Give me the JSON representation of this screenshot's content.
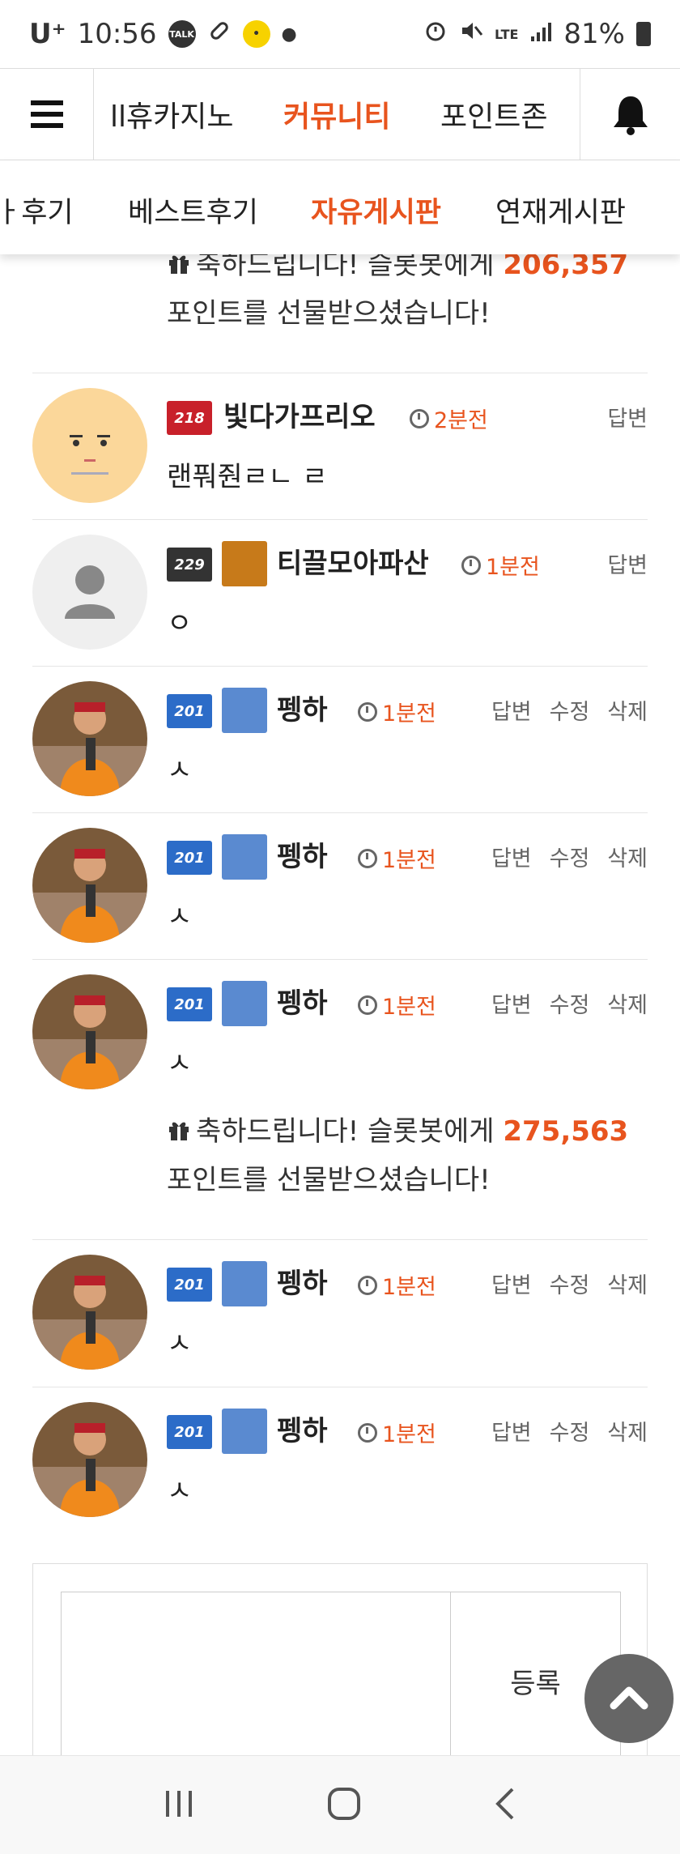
{
  "status_bar": {
    "carrier": "U⁺",
    "time": "10:56",
    "talk_icon": "TALK",
    "network": "LTE",
    "battery": "81%"
  },
  "top_nav": {
    "tabs": [
      {
        "label": "ll휴카지노",
        "active": false
      },
      {
        "label": "커뮤니티",
        "active": true
      },
      {
        "label": "포인트존",
        "active": false
      }
    ]
  },
  "sub_nav": {
    "tabs": [
      {
        "label": "ㅏ후기",
        "active": false
      },
      {
        "label": "베스트후기",
        "active": false
      },
      {
        "label": "자유게시판",
        "active": true
      },
      {
        "label": "연재게시판",
        "active": false
      }
    ]
  },
  "gifts": [
    {
      "prefix": "축하드립니다! 슬롯봇에게",
      "points": "206,357",
      "suffix": "포인트를 선물받으셨습니다!"
    },
    {
      "prefix": "축하드립니다! 슬롯봇에게",
      "points": "275,563",
      "suffix": "포인트를 선물받으셨습니다!"
    }
  ],
  "comments": [
    {
      "level": "218",
      "nickname": "빛다가프리오",
      "time": "2분전",
      "text": "랜풔줜ㄹㄴ ㄹ",
      "actions": [
        "답변"
      ],
      "avatar": "face-avatar"
    },
    {
      "level": "229",
      "nickname": "티끌모아파산",
      "time": "1분전",
      "text": "ㅇ",
      "actions": [
        "답변"
      ],
      "avatar": "default-avatar"
    },
    {
      "level": "201",
      "nickname": "펭하",
      "time": "1분전",
      "text": "ㅅ",
      "actions": [
        "답변",
        "수정",
        "삭제"
      ],
      "avatar": "photo-avatar"
    },
    {
      "level": "201",
      "nickname": "펭하",
      "time": "1분전",
      "text": "ㅅ",
      "actions": [
        "답변",
        "수정",
        "삭제"
      ],
      "avatar": "photo-avatar"
    },
    {
      "level": "201",
      "nickname": "펭하",
      "time": "1분전",
      "text": "ㅅ",
      "actions": [
        "답변",
        "수정",
        "삭제"
      ],
      "avatar": "photo-avatar"
    },
    {
      "level": "201",
      "nickname": "펭하",
      "time": "1분전",
      "text": "ㅅ",
      "actions": [
        "답변",
        "수정",
        "삭제"
      ],
      "avatar": "photo-avatar"
    },
    {
      "level": "201",
      "nickname": "펭하",
      "time": "1분전",
      "text": "ㅅ",
      "actions": [
        "답변",
        "수정",
        "삭제"
      ],
      "avatar": "photo-avatar"
    }
  ],
  "write": {
    "submit_label": "등록"
  },
  "colors": {
    "accent": "#e8541e"
  }
}
